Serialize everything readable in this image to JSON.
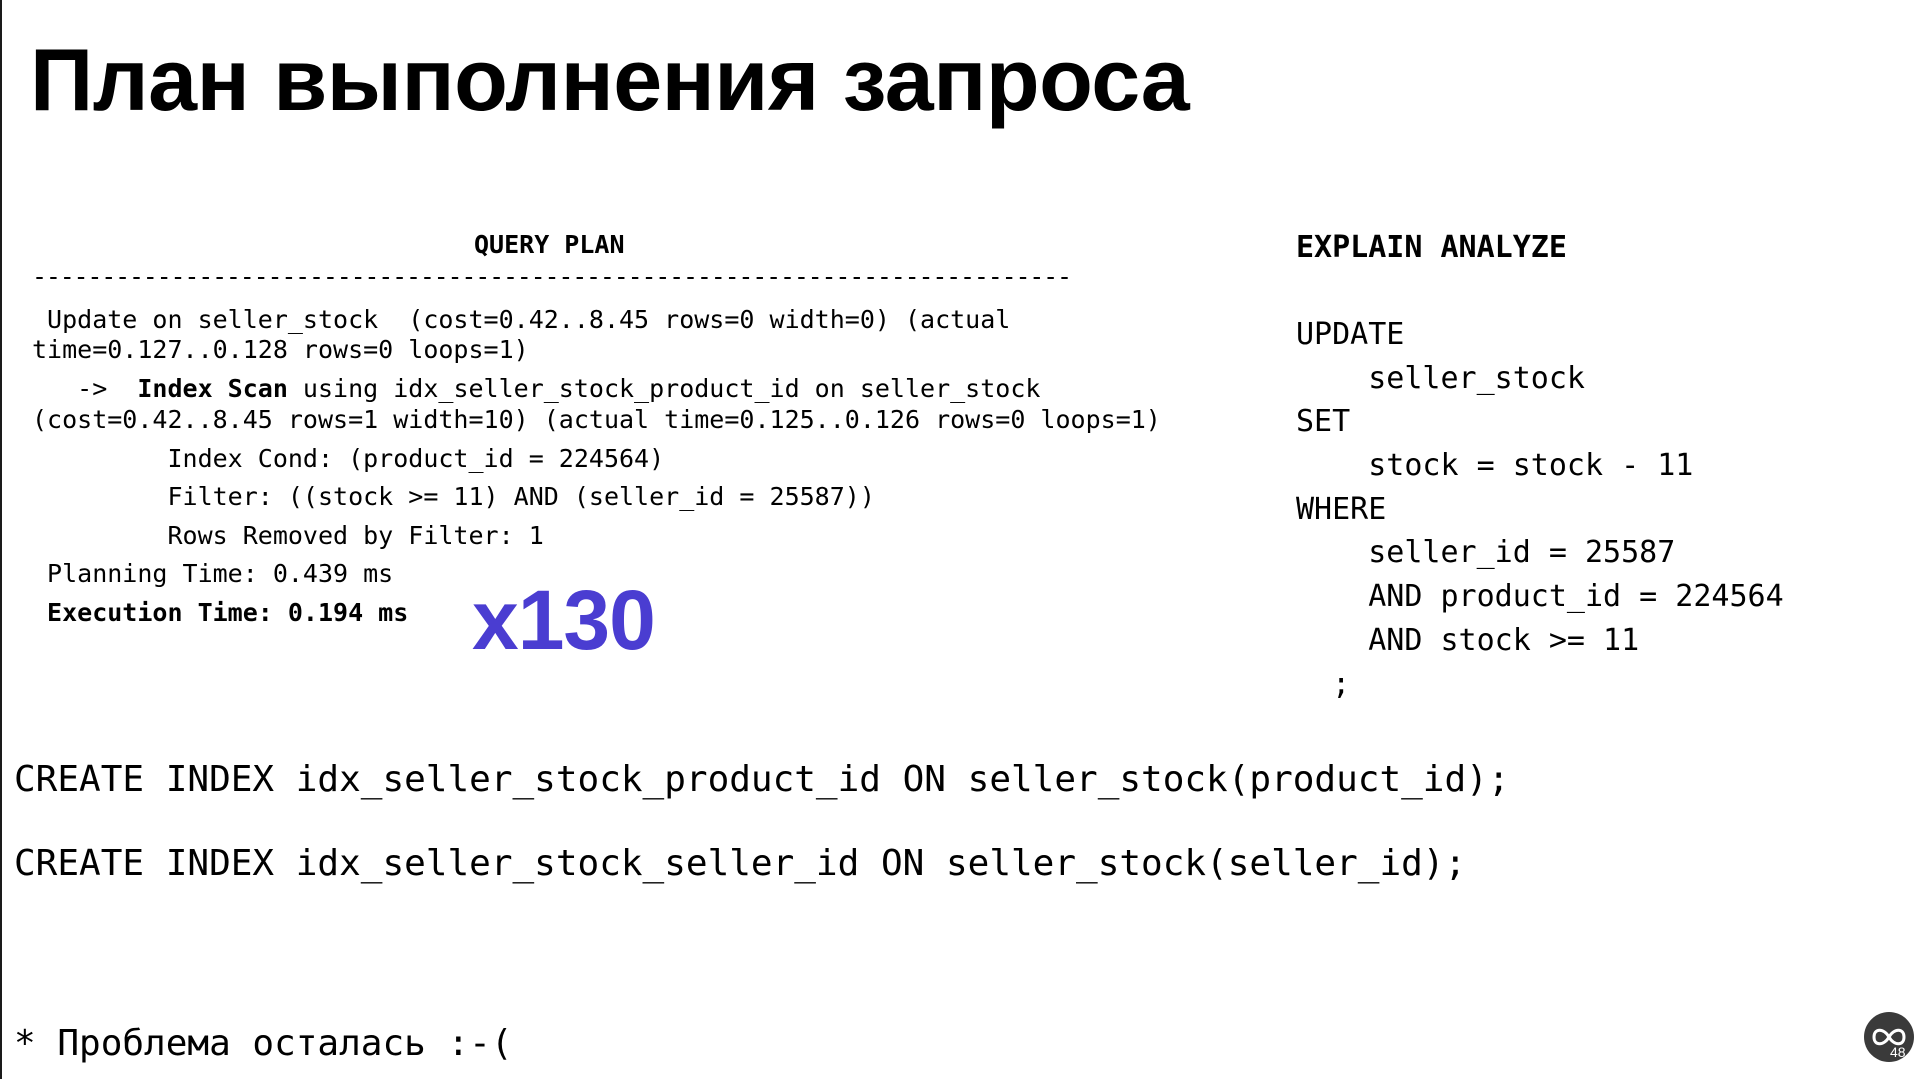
{
  "slide": {
    "title": "План выполнения запроса",
    "page_number": "48"
  },
  "query_plan": {
    "header": "QUERY PLAN",
    "divider": "---------------------------------------------------------------------------",
    "lines": [
      " Update on seller_stock  (cost=0.42..8.45 rows=0 width=0) (actual",
      "time=0.127..0.128 rows=0 loops=1)",
      "   ->  ",
      "Index Scan",
      " using idx_seller_stock_product_id on seller_stock",
      "(cost=0.42..8.45 rows=1 width=10) (actual time=0.125..0.126 rows=0 loops=1)",
      "         Index Cond: (product_id = 224564)",
      "         Filter: ((stock >= 11) AND (seller_id = 25587))",
      "         Rows Removed by Filter: 1",
      " Planning Time: 0.439 ms",
      " Execution Time: 0.194 ms"
    ],
    "speedup_badge": "x130"
  },
  "explain_analyze": {
    "header": "EXPLAIN ANALYZE",
    "lines": [
      "UPDATE",
      "    seller_stock",
      "SET",
      "    stock = stock - 11",
      "WHERE",
      "    seller_id = 25587",
      "    AND product_id = 224564",
      "    AND stock >= 11",
      "  ;"
    ]
  },
  "create_statements": [
    "CREATE INDEX idx_seller_stock_product_id ON seller_stock(product_id);",
    "CREATE INDEX idx_seller_stock_seller_id ON seller_stock(seller_id);"
  ],
  "footnote": "* Проблема осталась :-(",
  "colors": {
    "badge": "#4a3dd1",
    "text": "#000000",
    "background": "#ffffff"
  },
  "icons": {
    "logo": "conference-logo-icon"
  }
}
